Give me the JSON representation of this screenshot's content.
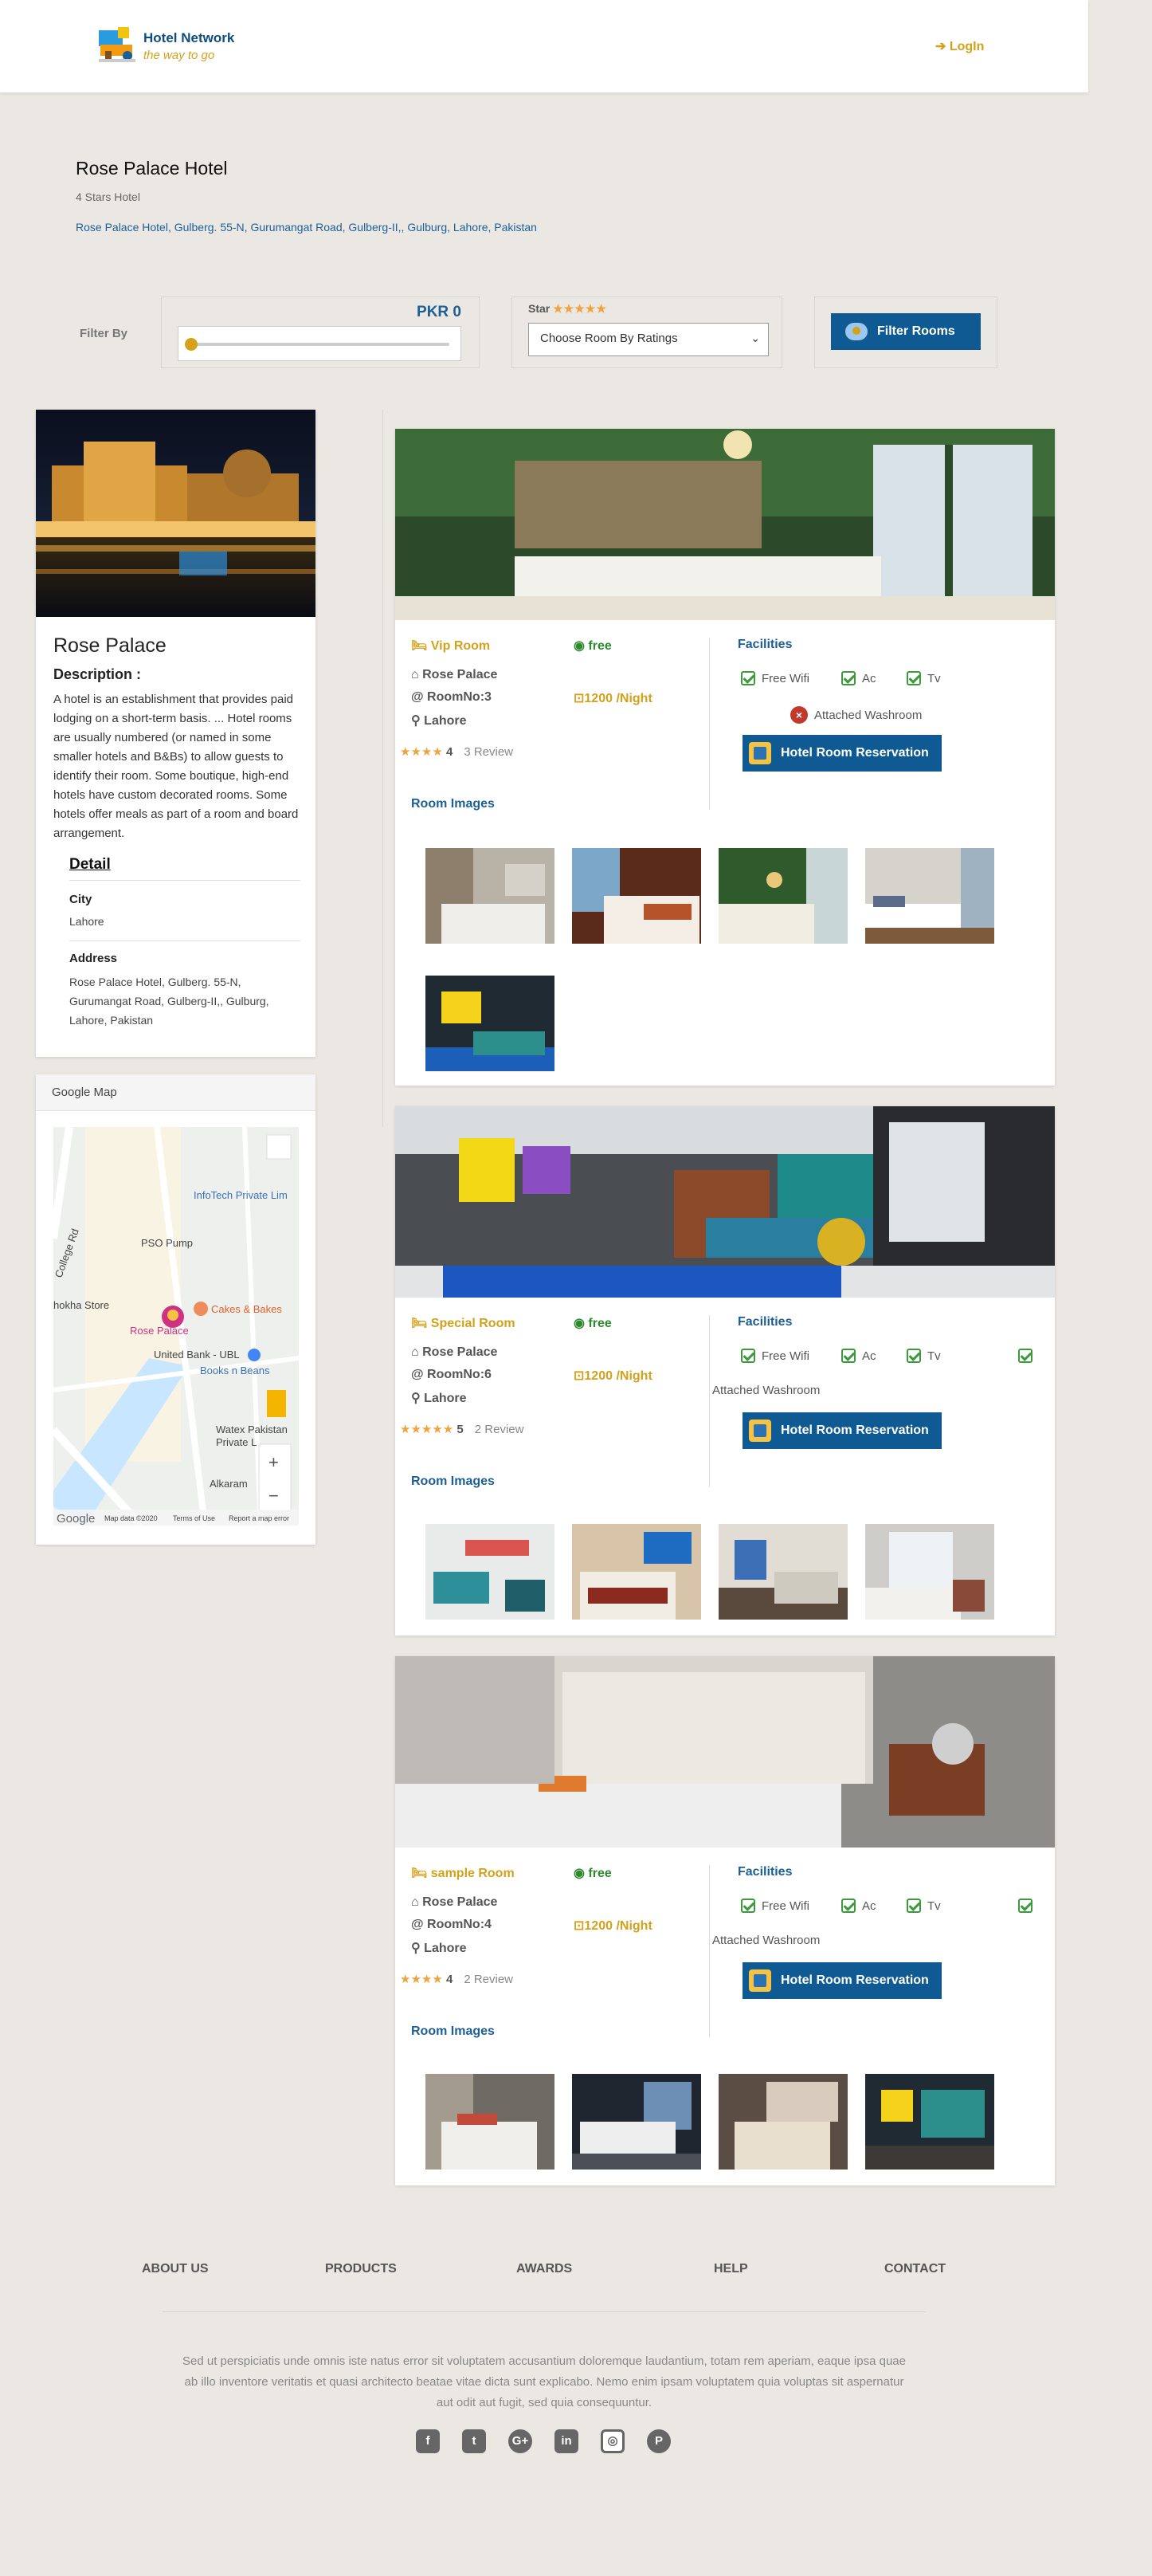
{
  "header": {
    "brand_name": "Hotel Network",
    "brand_tagline": "the way to go",
    "login_label": "LogIn"
  },
  "hotel": {
    "name": "Rose Palace Hotel",
    "stars_label": "4 Stars Hotel",
    "address": "Rose Palace Hotel, Gulberg. 55-N, Gurumangat Road, Gulberg-II,, Gulburg, Lahore, Pakistan"
  },
  "filter": {
    "label": "Filter By",
    "price_value": "PKR 0",
    "price_fraction": 0,
    "star_label": "Star",
    "star_icons": "★★★★★",
    "rating_select_value": "Choose Room By Ratings",
    "button_label": "Filter Rooms"
  },
  "sidebar": {
    "name": "Rose Palace",
    "description_title": "Description :",
    "description": "A hotel is an establishment that provides paid lodging on a short-term basis. ... Hotel rooms are usually numbered (or named in some smaller hotels and B&Bs) to allow guests to identify their room. Some boutique, high-end hotels have custom decorated rooms. Some hotels offer meals as part of a room and board arrangement.",
    "detail_title": "Detail",
    "city_label": "City",
    "city_value": "Lahore",
    "address_label": "Address",
    "address_value": "Rose Palace Hotel, Gulberg. 55-N, Gurumangat Road, Gulberg-II,, Gulburg, Lahore, Pakistan"
  },
  "map": {
    "title": "Google Map",
    "labels": [
      "InfoTech Private Lim",
      "PSO Pump",
      "College Rd",
      "hokha Store",
      "Cakes & Bakes",
      "Rose Palace",
      "United Bank - UBL",
      "Books n Beans",
      "Watex Pakistan",
      "Private L",
      "Alkaram",
      "Google",
      "Map data ©2020",
      "Terms of Use",
      "Report a map error"
    ]
  },
  "rooms": [
    {
      "name": "Vip Room",
      "free": "free",
      "hotel": "Rose Palace",
      "number": "RoomNo:3",
      "price": "1200 /Night",
      "city": "Lahore",
      "stars": "★★★★",
      "rating": "4",
      "reviews": "3 Review",
      "facilities_title": "Facilities",
      "f1": "Free Wifi",
      "f2": "Ac",
      "f3": "Tv",
      "f4": "Attached Washroom",
      "reserve_label": "Hotel Room Reservation",
      "images_title": "Room Images"
    },
    {
      "name": "Special Room",
      "free": "free",
      "hotel": "Rose Palace",
      "number": "RoomNo:6",
      "price": "1200 /Night",
      "city": "Lahore",
      "stars": "★★★★★",
      "rating": "5",
      "reviews": "2 Review",
      "facilities_title": "Facilities",
      "f1": "Free Wifi",
      "f2": "Ac",
      "f3": "Tv",
      "f4": "Attached Washroom",
      "reserve_label": "Hotel Room Reservation",
      "images_title": "Room Images"
    },
    {
      "name": "sample Room",
      "free": "free",
      "hotel": "Rose Palace",
      "number": "RoomNo:4",
      "price": "1200 /Night",
      "city": "Lahore",
      "stars": "★★★★",
      "rating": "4",
      "reviews": "2 Review",
      "facilities_title": "Facilities",
      "f1": "Free Wifi",
      "f2": "Ac",
      "f3": "Tv",
      "f4": "Attached Washroom",
      "reserve_label": "Hotel Room Reservation",
      "images_title": "Room Images"
    }
  ],
  "footer": {
    "nav": [
      "ABOUT US",
      "PRODUCTS",
      "AWARDS",
      "HELP",
      "CONTACT"
    ],
    "text": "Sed ut perspiciatis unde omnis iste natus error sit voluptatem accusantium doloremque laudantium, totam rem aperiam, eaque ipsa quae ab illo inventore veritatis et quasi architecto beatae vitae dicta sunt explicabo. Nemo enim ipsam voluptatem quia voluptas sit aspernatur aut odit aut fugit, sed quia consequuntur.",
    "social_icons": [
      "facebook-icon",
      "twitter-icon",
      "google-plus-icon",
      "linkedin-icon",
      "instagram-icon",
      "pinterest-icon"
    ]
  },
  "colors": {
    "accent": "#d4a11a",
    "brand_blue": "#0f5a93",
    "link_blue": "#1c5f96",
    "free_green": "#2c8a2c",
    "star": "#f0a23c",
    "page_bg": "#ebe8e3"
  }
}
